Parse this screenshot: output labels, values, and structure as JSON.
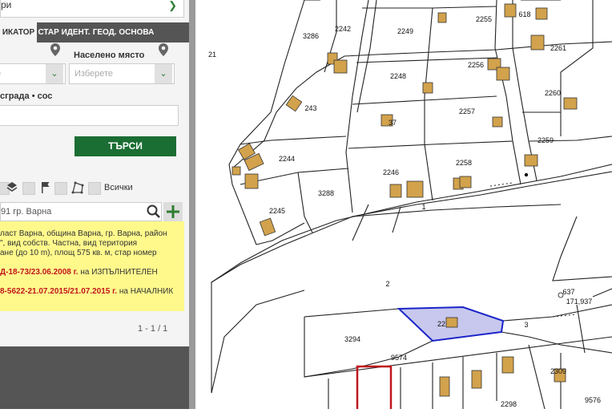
{
  "panel": {
    "top_select_text": "ри",
    "tabs": [
      "ИКАТОР",
      "СТАР ИДЕНТ.",
      "ГЕОД. ОСНОВА"
    ],
    "settlement_label": "Населено място",
    "settlement_placeholder": "Изберете",
    "left_select_placeholder": "е",
    "building_label": "сграда • сос",
    "search_button": "ТЪРСИ",
    "layers_all_label": "Всички",
    "result_search_value": "91 гр. Варна",
    "info_lines": [
      "ласт Варна, община Варна, гр. Варна, район",
      "\", вид собств. Частна, вид територия",
      "ане (до 10 m), площ 575 кв. м, стар номер"
    ],
    "order1_bold": "Д-18-73/23.06.2008 г.",
    "order1_rest": " на ИЗПЪЛНИТЕЛЕН",
    "order2_bold": "8-5622-21.07.2015/21.07.2015 г.",
    "order2_rest": " на НАЧАЛНИК",
    "pager": "1 - 1 / 1"
  },
  "map": {
    "parcel_labels": [
      "21",
      "3286",
      "2242",
      "2249",
      "2255",
      "618",
      "2261",
      "2248",
      "2256",
      "2260",
      "243",
      "2257",
      "37",
      "2244",
      "2259",
      "2258",
      "2246",
      "3288",
      "2245",
      "1",
      "2",
      "637",
      "171,937",
      "3",
      "3294",
      "9574",
      "2298",
      "2309",
      "9576",
      "22"
    ],
    "selected_parcel_label": "22",
    "colors": {
      "building": "#d2a24c",
      "selected_fill": "#c8c8ee",
      "selected_stroke": "#1a24c8",
      "red_parcel": "#c0161c"
    }
  }
}
